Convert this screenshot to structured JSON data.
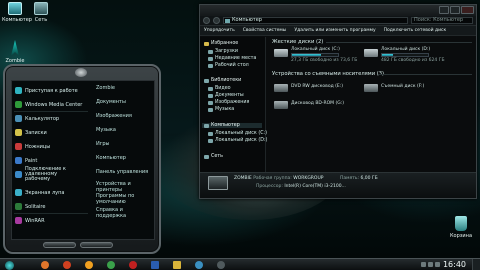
{
  "desktop": {
    "icons": {
      "computer": "Компьютер",
      "network": "Сеть",
      "zombie": "Zombie",
      "recycle": "Корзина"
    }
  },
  "start_menu": {
    "left_items": [
      {
        "label": "Приступая к работе",
        "icon": "getting-started-icon",
        "color": "#2fb3c0"
      },
      {
        "label": "Windows Media Center",
        "icon": "media-center-icon",
        "color": "#2f9a3a"
      },
      {
        "label": "Калькулятор",
        "icon": "calculator-icon",
        "color": "#4a8fb6"
      },
      {
        "label": "Записки",
        "icon": "sticky-notes-icon",
        "color": "#d3c24a"
      },
      {
        "label": "Ножницы",
        "icon": "scissors-icon",
        "color": "#c93b3b"
      },
      {
        "label": "Paint",
        "icon": "paint-icon",
        "color": "#3b79c9"
      },
      {
        "label": "Подключение к удаленному рабочему",
        "icon": "remote-desktop-icon",
        "color": "#3b8ac9"
      },
      {
        "label": "Экранная лупа",
        "icon": "magnifier-icon",
        "color": "#3bb0c9"
      },
      {
        "label": "Solitaire",
        "icon": "solitaire-icon",
        "color": "#2c7a3a"
      },
      {
        "label": "WinRAR",
        "icon": "winrar-icon",
        "color": "#a83aa0"
      }
    ],
    "right_items": [
      "Zombie",
      "Документы",
      "Изображения",
      "Музыка",
      "Игры",
      "Компьютер",
      "Панель управления",
      "Устройства и принтеры",
      "Программы по умолчанию",
      "Справка и поддержка"
    ]
  },
  "explorer": {
    "address": "Компьютер",
    "search_placeholder": "Поиск: Компьютер",
    "commands": [
      "Упорядочить",
      "Свойства системы",
      "Удалить или изменить программу",
      "Подключить сетевой диск"
    ],
    "nav": {
      "favorites": "Избранное",
      "favorites_items": [
        "Загрузки",
        "Недавние места",
        "Рабочий стол"
      ],
      "libraries": "Библиотеки",
      "libraries_items": [
        "Видео",
        "Документы",
        "Изображения",
        "Музыка"
      ],
      "computer": "Компьютер",
      "computer_items": [
        "Локальный диск (C:)",
        "Локальный диск (D:)"
      ],
      "network": "Сеть"
    },
    "groups": {
      "hard_disks": "Жесткие диски (2)",
      "removable": "Устройства со съемными носителями (3)"
    },
    "drives": [
      {
        "name": "Локальный диск (C:)",
        "free": "27,3 ГБ свободно из 73,6 ГБ",
        "used_percent": 63
      },
      {
        "name": "Локальный диск (D:)",
        "free": "482 ГБ свободно из 624 ГБ",
        "used_percent": 23
      }
    ],
    "removable": [
      {
        "name": "DVD RW дисковод (E:)"
      },
      {
        "name": "Съемный диск (F:)"
      },
      {
        "name": "Дисковод BD-ROM (G:)"
      }
    ],
    "details": {
      "name": "ZOMBIE",
      "workgroup_label": "Рабочая группа:",
      "workgroup": "WORKGROUP",
      "memory_label": "Память:",
      "memory": "6,00 ГБ",
      "cpu_label": "Процессор:",
      "cpu": "Intel(R) Core(TM) i3-2100..."
    }
  },
  "taskbar": {
    "clock": "16:40",
    "apps": [
      {
        "icon": "firefox-icon",
        "color": "#e0762b"
      },
      {
        "icon": "media-player-icon",
        "color": "#d04020"
      },
      {
        "icon": "chat-icon",
        "color": "#f0a020"
      },
      {
        "icon": "chrome-icon",
        "color": "#3aa04a"
      },
      {
        "icon": "opera-icon",
        "color": "#c02020"
      },
      {
        "icon": "word-icon",
        "color": "#2a5db0"
      },
      {
        "icon": "folder-icon",
        "color": "#d9b43a"
      },
      {
        "icon": "people-icon",
        "color": "#3a8fc0"
      },
      {
        "icon": "player-icon",
        "color": "#505a5d"
      }
    ]
  }
}
